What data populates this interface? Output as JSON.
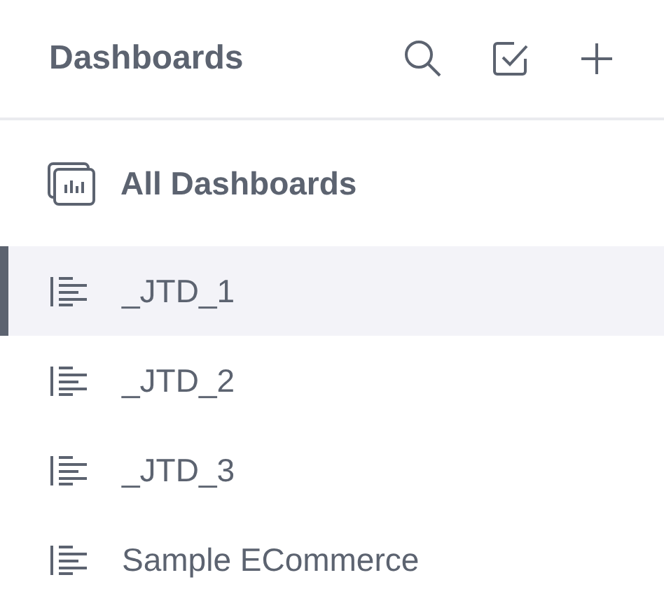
{
  "header": {
    "title": "Dashboards"
  },
  "all_dashboards": {
    "label": "All Dashboards"
  },
  "dashboards": [
    {
      "label": "_JTD_1",
      "selected": true
    },
    {
      "label": "_JTD_2",
      "selected": false
    },
    {
      "label": "_JTD_3",
      "selected": false
    },
    {
      "label": "Sample ECommerce",
      "selected": false
    }
  ]
}
